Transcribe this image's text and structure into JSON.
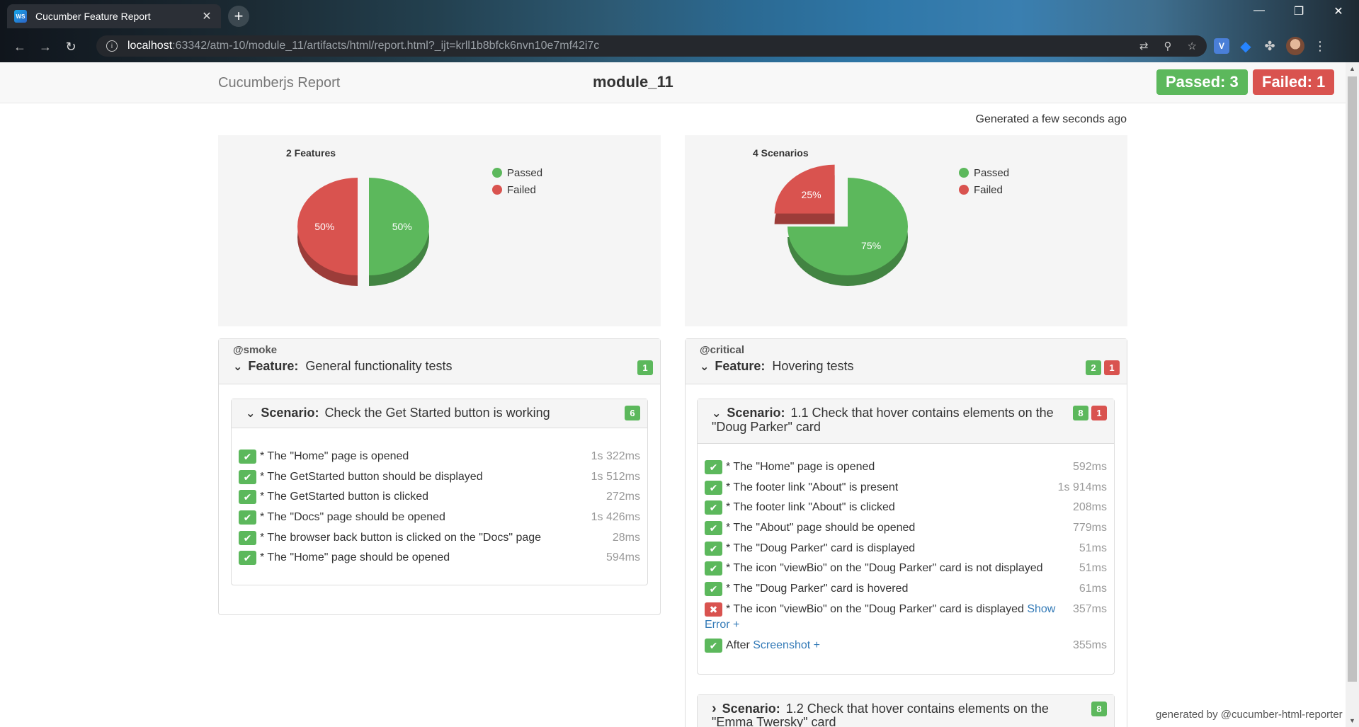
{
  "browser": {
    "tab_title": "Cucumber Feature Report",
    "favicon_label": "WS",
    "url_host": "localhost",
    "url_path": ":63342/atm-10/module_11/artifacts/html/report.html?_ijt=krll1b8bfck6nvn10e7mf42i7c",
    "extension_v_label": "V",
    "colors": {
      "extension_v": "#4a7fd8",
      "extension_jira": "#2684ff"
    }
  },
  "navbar": {
    "brand": "Cucumberjs Report",
    "project": "module_11",
    "passed_badge": "Passed: 3",
    "failed_badge": "Failed: 1"
  },
  "generated_text": "Generated a few seconds ago",
  "chart_data": [
    {
      "type": "pie",
      "title": "2 Features",
      "slices": [
        {
          "label": "Passed",
          "value": 50,
          "display": "50%",
          "color": "#5cb85c"
        },
        {
          "label": "Failed",
          "value": 50,
          "display": "50%",
          "color": "#d9534f"
        }
      ],
      "legend": [
        "Passed",
        "Failed"
      ],
      "legend_position": "right"
    },
    {
      "type": "pie",
      "title": "4 Scenarios",
      "slices": [
        {
          "label": "Passed",
          "value": 75,
          "display": "75%",
          "color": "#5cb85c"
        },
        {
          "label": "Failed",
          "value": 25,
          "display": "25%",
          "color": "#d9534f"
        }
      ],
      "legend": [
        "Passed",
        "Failed"
      ],
      "legend_position": "right"
    }
  ],
  "features": [
    {
      "tag": "@smoke",
      "keyword": "Feature:",
      "name": "General functionality tests",
      "passed_count": "1",
      "scenarios": [
        {
          "keyword": "Scenario:",
          "name": "Check the Get Started button is working",
          "passed_count": "6",
          "steps": [
            {
              "text": "* The \"Home\" page is opened",
              "duration": "1s 322ms"
            },
            {
              "text": "* The GetStarted button should be displayed",
              "duration": "1s 512ms"
            },
            {
              "text": "* The GetStarted button is clicked",
              "duration": "272ms"
            },
            {
              "text": "* The \"Docs\" page should be opened",
              "duration": "1s 426ms"
            },
            {
              "text": "* The browser back button is clicked on the \"Docs\" page",
              "duration": "28ms"
            },
            {
              "text": "* The \"Home\" page should be opened",
              "duration": "594ms"
            }
          ]
        }
      ]
    },
    {
      "tag": "@critical",
      "keyword": "Feature:",
      "name": "Hovering tests",
      "passed_count": "2",
      "failed_count": "1",
      "scenarios": [
        {
          "keyword": "Scenario:",
          "name": "1.1 Check that hover contains elements on the \"Doug Parker\" card",
          "passed_count": "8",
          "failed_count": "1",
          "steps": [
            {
              "text": "* The \"Home\" page is opened",
              "duration": "592ms"
            },
            {
              "text": "* The footer link \"About\" is present",
              "duration": "1s 914ms"
            },
            {
              "text": "* The footer link \"About\" is clicked",
              "duration": "208ms"
            },
            {
              "text": "* The \"About\" page should be opened",
              "duration": "779ms"
            },
            {
              "text": "* The \"Doug Parker\" card is displayed",
              "duration": "51ms"
            },
            {
              "text": "* The icon \"viewBio\" on the \"Doug Parker\" card is not displayed",
              "duration": "51ms"
            },
            {
              "text": "* The \"Doug Parker\" card is hovered",
              "duration": "61ms"
            },
            {
              "text": "* The icon \"viewBio\" on the \"Doug Parker\" card is displayed",
              "link": "Show Error +",
              "duration": "357ms"
            },
            {
              "text": "After",
              "link": "Screenshot +",
              "duration": "355ms"
            }
          ]
        },
        {
          "keyword": "Scenario:",
          "name": "1.2 Check that hover contains elements on the \"Emma Twersky\" card",
          "passed_count": "8"
        }
      ]
    }
  ],
  "footer": "generated by @cucumber-html-reporter",
  "icons": {
    "check": "✔",
    "cross": "✖",
    "chevron_down": "⌄",
    "chevron_right": "›"
  },
  "browser_icons": {
    "close": "✕",
    "new_tab": "+",
    "minimize": "—",
    "restore": "❐",
    "back": "←",
    "forward": "→",
    "reload": "↻",
    "info": "i",
    "translate": "⇄",
    "zoom": "⚲",
    "bookmark": "☆",
    "extensions": "✤",
    "menu": "⋮",
    "jira": "◆"
  },
  "scrollbar_arrows": {
    "up": "▲",
    "down": "▼"
  }
}
